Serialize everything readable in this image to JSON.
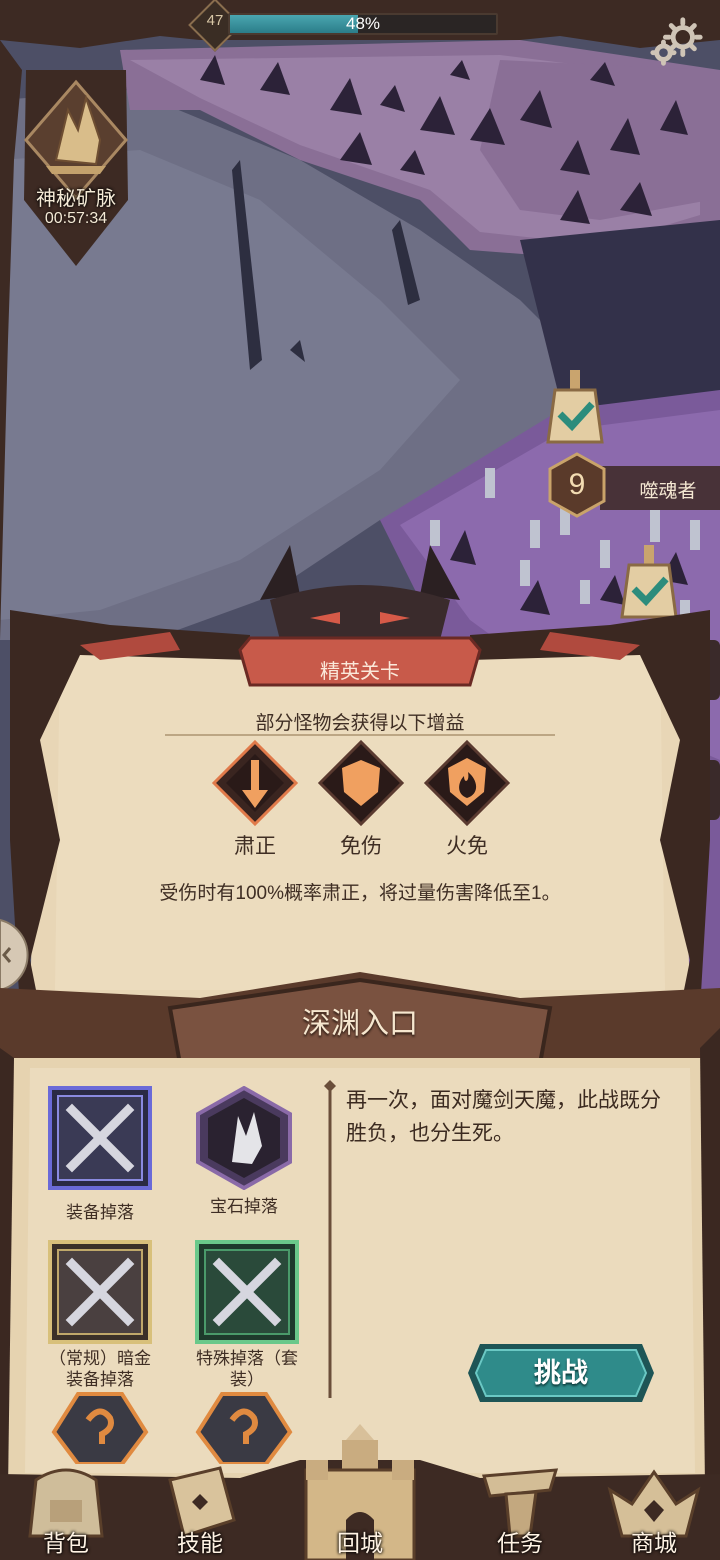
{
  "player": {
    "level": "47",
    "xp_text": "48%",
    "xp_fraction": 0.48
  },
  "mine": {
    "title": "神秘矿脉",
    "timer": "00:57:34"
  },
  "map_node": {
    "number": "9",
    "name": "噬魂者"
  },
  "elite": {
    "title": "精英关卡",
    "subtitle": "部分怪物会获得以下增益",
    "buffs": [
      {
        "label": "肃正",
        "icon": "sword-down-icon"
      },
      {
        "label": "免伤",
        "icon": "shield-icon"
      },
      {
        "label": "火免",
        "icon": "flame-icon"
      }
    ],
    "description": "受伤时有100%概率肃正，将过量伤害降低至1。"
  },
  "abyss": {
    "title": "深渊入口",
    "drops": [
      {
        "label": "装备掉落",
        "icon": "crossed-swords-icon"
      },
      {
        "label": "宝石掉落",
        "icon": "gem-icon"
      },
      {
        "label": "（常规）暗金\n装备掉落",
        "icon": "crossed-swords-icon"
      },
      {
        "label": "特殊掉落（套\n装）",
        "icon": "crossed-swords-icon"
      },
      {
        "label": "",
        "icon": "mystery-stone-icon"
      },
      {
        "label": "",
        "icon": "mystery-stone-icon"
      }
    ],
    "story": "再一次，面对魔剑天魔，此战既分胜负，也分生死。",
    "challenge_label": "挑战"
  },
  "nav": [
    {
      "label": "背包",
      "icon": "backpack-icon"
    },
    {
      "label": "技能",
      "icon": "skill-book-icon"
    },
    {
      "label": "回城",
      "icon": "castle-icon"
    },
    {
      "label": "任务",
      "icon": "scroll-icon"
    },
    {
      "label": "商城",
      "icon": "crown-shop-icon"
    }
  ],
  "colors": {
    "parchment": "#e8d6b6",
    "wood": "#4a3129",
    "elite_ribbon": "#c85a4a",
    "challenge_teal": "#2f8b8a",
    "purple_map": "#7a5a8f"
  }
}
